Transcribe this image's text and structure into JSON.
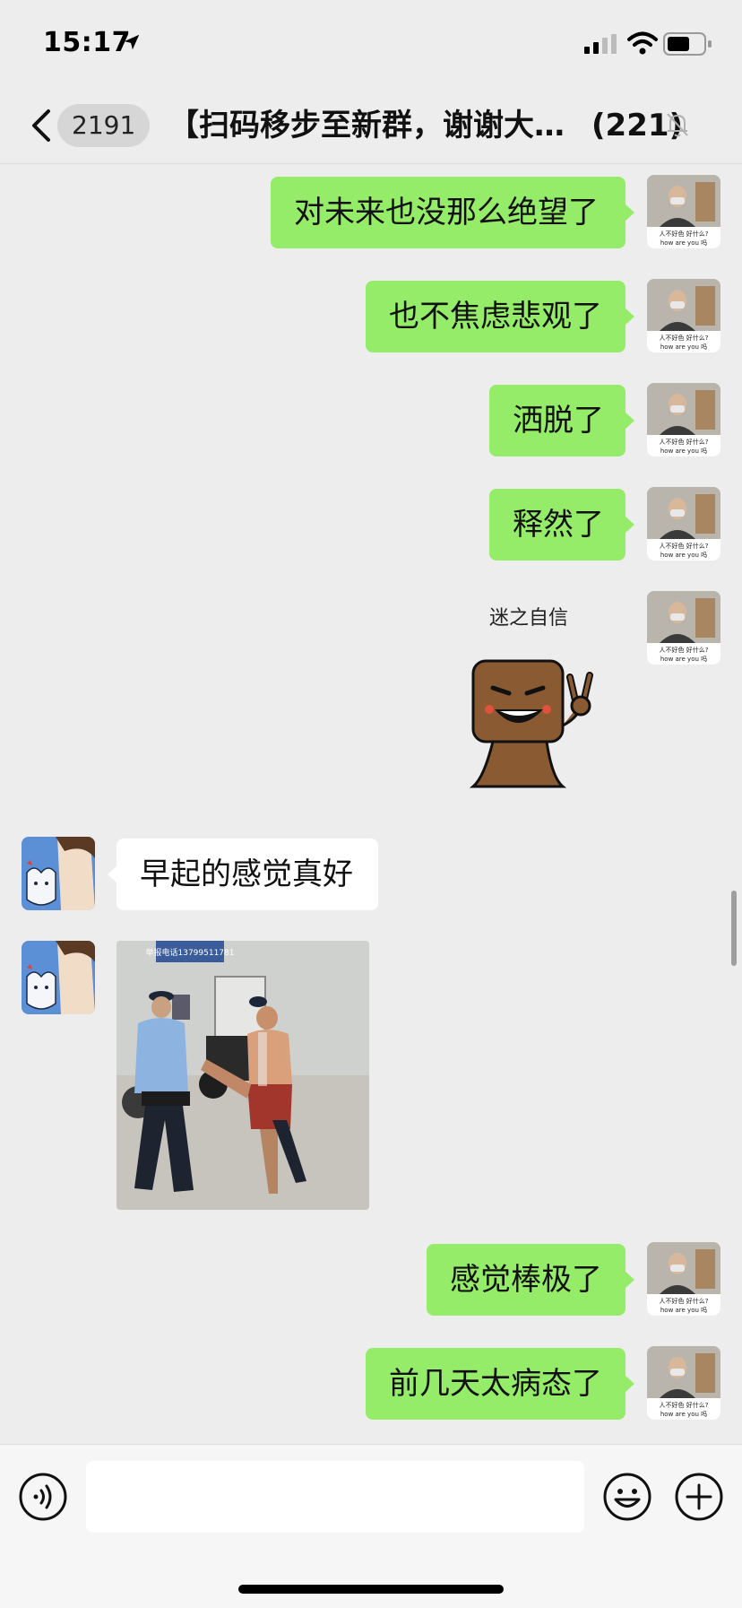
{
  "status_bar": {
    "time": "15:17",
    "icons": [
      "location-arrow-icon",
      "cellular-signal-icon",
      "wifi-icon",
      "battery-icon"
    ]
  },
  "nav": {
    "unread_count": "2191",
    "title": "【扫码移步至新群，谢谢大…",
    "member_count": "(221)",
    "icons": [
      "back-chevron-icon",
      "mute-bell-icon"
    ]
  },
  "messages": [
    {
      "sender": "self",
      "type": "text",
      "text": "对未来也没那么绝望了"
    },
    {
      "sender": "self",
      "type": "text",
      "text": "也不焦虑悲观了"
    },
    {
      "sender": "self",
      "type": "text",
      "text": "洒脱了"
    },
    {
      "sender": "self",
      "type": "text",
      "text": "释然了"
    },
    {
      "sender": "self",
      "type": "sticker",
      "caption": "迷之自信"
    },
    {
      "sender": "other",
      "type": "text",
      "text": "早起的感觉真好"
    },
    {
      "sender": "other",
      "type": "image",
      "sign_text": "举报电话13799511781"
    },
    {
      "sender": "self",
      "type": "text",
      "text": "感觉棒极了"
    },
    {
      "sender": "self",
      "type": "text",
      "text": "前几天太病态了"
    }
  ],
  "self_avatar": {
    "caption_line1": "人不好色 好什么?",
    "caption_line2": "how are you 吗"
  },
  "input_bar": {
    "value": "",
    "placeholder": "",
    "icons": [
      "voice-icon",
      "emoji-icon",
      "plus-icon"
    ]
  },
  "colors": {
    "background": "#ededed",
    "self_bubble": "#95ec69",
    "other_bubble": "#ffffff",
    "input_bar": "#f6f6f6"
  }
}
